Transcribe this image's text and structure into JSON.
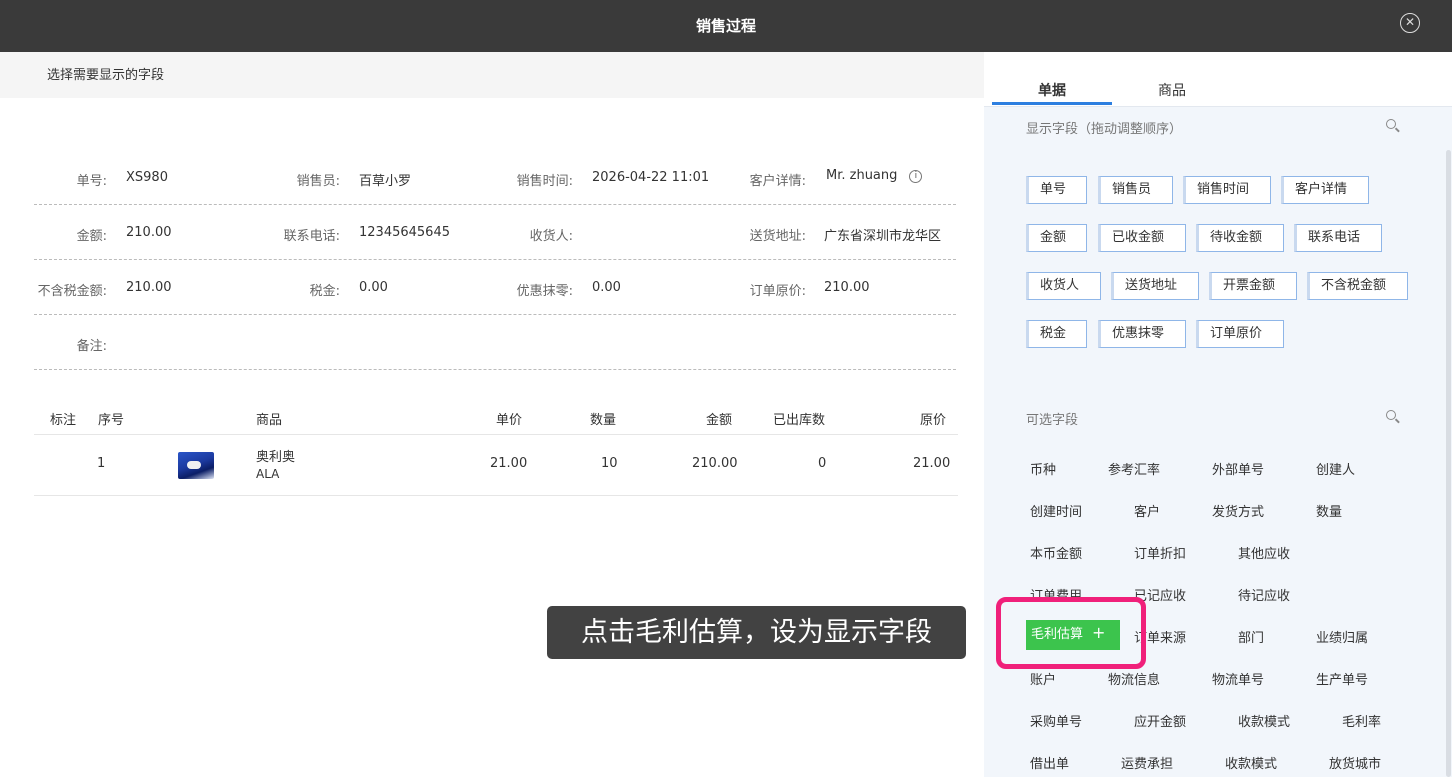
{
  "header": {
    "title": "销售过程",
    "close_glyph": "✕"
  },
  "subbar": {
    "label": "选择需要显示的字段"
  },
  "info": {
    "rows": [
      [
        {
          "label": "单号:",
          "value": "XS980"
        },
        {
          "label": "销售员:",
          "value": "百草小罗"
        },
        {
          "label": "销售时间:",
          "value": "2026-04-22 11:01"
        },
        {
          "label": "客户详情:",
          "value": "Mr. zhuang"
        }
      ],
      [
        {
          "label": "金额:",
          "value": "210.00"
        },
        {
          "label": "联系电话:",
          "value": "12345645645"
        },
        {
          "label": "收货人:",
          "value": ""
        },
        {
          "label": "送货地址:",
          "value": "广东省深圳市龙华区"
        }
      ],
      [
        {
          "label": "不含税金额:",
          "value": "210.00"
        },
        {
          "label": "税金:",
          "value": "0.00"
        },
        {
          "label": "优惠抹零:",
          "value": "0.00"
        },
        {
          "label": "订单原价:",
          "value": "210.00"
        }
      ],
      [
        {
          "label": "备注:",
          "value": ""
        }
      ]
    ],
    "info_glyph": "i"
  },
  "table": {
    "headers": [
      "标注",
      "序号",
      "商品",
      "单价",
      "数量",
      "金额",
      "已出库数",
      "原价"
    ],
    "rows": [
      {
        "index": "1",
        "product_name": "奥利奥",
        "product_code": "ALA",
        "unit_price": "21.00",
        "quantity": "10",
        "amount": "210.00",
        "shipped": "0",
        "original_price": "21.00"
      }
    ]
  },
  "right_panel": {
    "tabs": [
      "单据",
      "商品"
    ],
    "display_title": "显示字段（拖动调整顺序）",
    "display_fields": [
      "单号",
      "销售员",
      "销售时间",
      "客户详情",
      "金额",
      "已收金额",
      "待收金额",
      "联系电话",
      "收货人",
      "送货地址",
      "开票金额",
      "不含税金额",
      "税金",
      "优惠抹零",
      "订单原价"
    ],
    "optional_title": "可选字段",
    "optional_fields": [
      "币种",
      "参考汇率",
      "外部单号",
      "创建人",
      "创建时间",
      "客户",
      "发货方式",
      "数量",
      "本币金额",
      "订单折扣",
      "其他应收",
      "订单费用",
      "已记应收",
      "待记应收",
      "毛利估算",
      "订单来源",
      "部门",
      "业绩归属",
      "账户",
      "物流信息",
      "物流单号",
      "生产单号",
      "采购单号",
      "应开金额",
      "收款模式",
      "毛利率",
      "借出单",
      "运费承担",
      "收款模式",
      "放货城市"
    ],
    "add_glyph": "+"
  },
  "caption": "点击毛利估算，设为显示字段",
  "colors": {
    "accent": "#2d7fe0",
    "highlight": "#f0207a",
    "active_button": "#3cc44d",
    "topbar": "#3a3a3a"
  }
}
